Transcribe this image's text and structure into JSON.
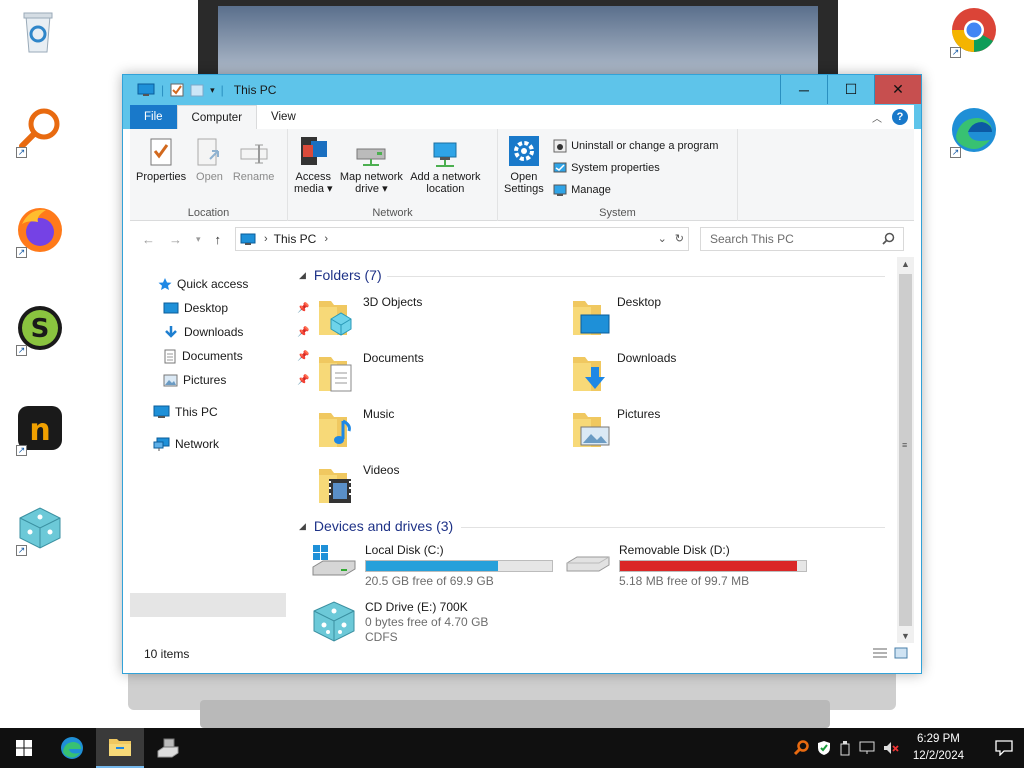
{
  "window": {
    "title": "This PC",
    "minimize_label": "─",
    "maximize_label": "☐",
    "close_label": "✕"
  },
  "ribbon_tabs": [
    "File",
    "Computer",
    "View"
  ],
  "ribbon": {
    "location": {
      "label": "Location",
      "buttons": [
        "Properties",
        "Open",
        "Rename"
      ]
    },
    "network": {
      "label": "Network",
      "access_media": [
        "Access",
        "media ▾"
      ],
      "map_drive": [
        "Map network",
        "drive ▾"
      ],
      "add_location": [
        "Add a network",
        "location"
      ]
    },
    "system": {
      "label": "System",
      "open_settings": [
        "Open",
        "Settings"
      ],
      "uninstall": "Uninstall or change a program",
      "system_properties": "System properties",
      "manage": "Manage"
    }
  },
  "address": {
    "breadcrumb": "This PC",
    "search_placeholder": "Search This PC"
  },
  "nav": {
    "quick_access": "Quick access",
    "desktop": "Desktop",
    "downloads": "Downloads",
    "documents": "Documents",
    "pictures": "Pictures",
    "this_pc": "This PC",
    "network": "Network"
  },
  "folders_header": "Folders (7)",
  "folders": [
    "3D Objects",
    "Desktop",
    "Documents",
    "Downloads",
    "Music",
    "Pictures",
    "Videos"
  ],
  "devices_header": "Devices and drives (3)",
  "drives": {
    "c": {
      "name": "Local Disk (C:)",
      "free": "20.5 GB free of 69.9 GB",
      "used_fraction": 0.71,
      "color": "#26a0da"
    },
    "d": {
      "name": "Removable Disk (D:)",
      "free": "5.18 MB free of 99.7 MB",
      "used_fraction": 0.95,
      "color": "#da2626"
    },
    "e": {
      "name": "CD Drive (E:) 700K",
      "free": "0 bytes free of 4.70 GB",
      "fs": "CDFS"
    }
  },
  "status": {
    "items": "10 items"
  },
  "taskbar": {
    "time": "6:29 PM",
    "date": "12/2/2024"
  },
  "colors": {
    "title_bar": "#5ec4ea",
    "file_tab": "#1979ca",
    "section_header": "#1e3287"
  }
}
